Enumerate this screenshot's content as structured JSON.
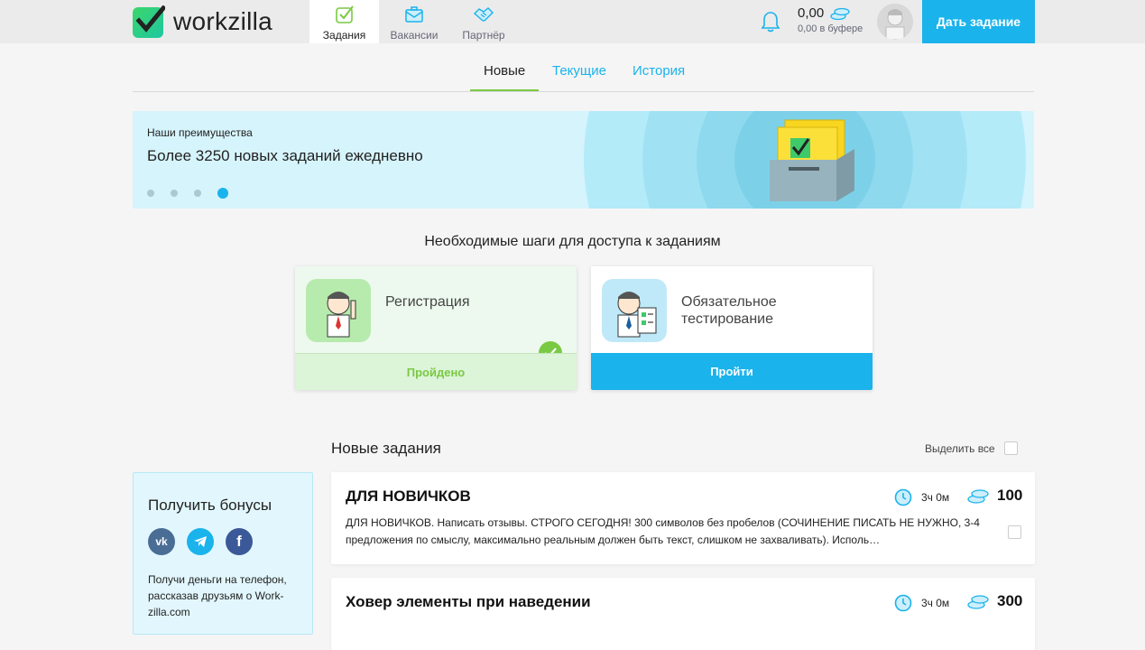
{
  "header": {
    "logo_text": "workzilla",
    "tabs": [
      {
        "label": "Задания",
        "icon": "tasks-check-icon",
        "active": true
      },
      {
        "label": "Вакансии",
        "icon": "briefcase-icon",
        "active": false
      },
      {
        "label": "Партнёр",
        "icon": "handshake-icon",
        "active": false
      }
    ],
    "balance": "0,00",
    "buffer": "0,00 в буфере",
    "give_task_label": "Дать задание"
  },
  "subtabs": [
    {
      "label": "Новые",
      "active": true
    },
    {
      "label": "Текущие",
      "active": false
    },
    {
      "label": "История",
      "active": false
    }
  ],
  "banner": {
    "kicker": "Наши преимущества",
    "headline": "Более 3250 новых заданий ежедневно",
    "slides": 4,
    "active_slide": 4
  },
  "steps": {
    "title": "Необходимые шаги для доступа к заданиям",
    "items": [
      {
        "name": "Регистрация",
        "status_label": "Пройдено",
        "done": true
      },
      {
        "name_line1": "Обязательное",
        "name_line2": "тестирование",
        "action_label": "Пройти",
        "done": false
      }
    ]
  },
  "tasks": {
    "title": "Новые задания",
    "select_all_label": "Выделить все",
    "items": [
      {
        "title": "ДЛЯ НОВИЧКОВ",
        "time": "3ч 0м",
        "price": "100",
        "description": "ДЛЯ НОВИЧКОВ. Написать отзывы. СТРОГО СЕГОДНЯ! 300 символов без пробелов (СОЧИНЕНИЕ ПИСАТЬ НЕ НУЖНО, 3-4 предложения по смыслу, максимально реальным должен быть текст, слишком не захваливать). Исполь…"
      },
      {
        "title": "Ховер элементы при наведении",
        "time": "3ч 0м",
        "price": "300"
      }
    ]
  },
  "bonus": {
    "title": "Получить бонусы",
    "socials": [
      {
        "name": "vk",
        "glyph": "vk"
      },
      {
        "name": "telegram",
        "glyph": ""
      },
      {
        "name": "facebook",
        "glyph": "f"
      }
    ],
    "text": "Получи деньги на телефон, рассказав друзьям о Work-zilla.com"
  },
  "colors": {
    "accent_blue": "#1ab3ec",
    "accent_green": "#7ac943",
    "logo_green": "#20d084",
    "topbar_bg": "#ebebeb",
    "banner_bg": "#d6f4fc"
  }
}
